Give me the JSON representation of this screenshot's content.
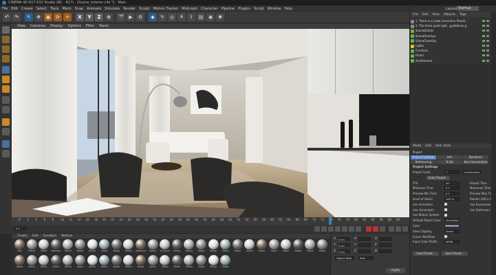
{
  "title": "CINEMA 4D R17.032 Studio (RC - R17) - [Scene_Interior.c4d *] - Main",
  "menubar": [
    "File",
    "Edit",
    "Create",
    "Select",
    "Tools",
    "Mesh",
    "Snap",
    "Animate",
    "Simulate",
    "Render",
    "Sculpt",
    "Motion Tracker",
    "MoGraph",
    "Character",
    "Pipeline",
    "Plugins",
    "Script",
    "Window",
    "Help"
  ],
  "axis_buttons": [
    "X",
    "Y",
    "Z"
  ],
  "viewport_menu": [
    "View",
    "Cameras",
    "Display",
    "Options",
    "Filter",
    "Panel"
  ],
  "timeline_ticks": [
    "0",
    "2",
    "4",
    "6",
    "8",
    "10",
    "12",
    "14",
    "16",
    "18",
    "20",
    "22",
    "24",
    "26",
    "28",
    "30",
    "32",
    "34",
    "36",
    "38",
    "40",
    "42",
    "44",
    "46",
    "48",
    "50",
    "52",
    "54",
    "56",
    "58",
    "60",
    "62",
    "64",
    "66",
    "68",
    "70",
    "72",
    "74",
    "76",
    "78",
    "80",
    "82",
    "84",
    "86",
    "88",
    "90"
  ],
  "timeline_end": "0 F",
  "material_menu": [
    "Create",
    "Edit",
    "Function",
    "Texture"
  ],
  "materials_row1": [
    "Mat",
    "Metal",
    "Metal",
    "Material",
    "Metal",
    "Metal",
    "Metal",
    "Glass",
    "Metal",
    "Metal",
    "Material",
    "Metal",
    "Chrome",
    "Metal",
    "Metal",
    "Metal",
    "Metal",
    "Metal",
    "Wood",
    "Metal",
    "Metal",
    "Glass",
    "Metal",
    "Metal",
    "Metal",
    "Metal"
  ],
  "materials_row2": [
    "Metal",
    "Metal",
    "Metal",
    "Metal",
    "Metal",
    "Metal",
    "Metal",
    "Metal",
    "Metal",
    "Metal",
    "Metal",
    "Metal",
    "Metal",
    "Metal",
    "Metal",
    "Metal",
    "Metal",
    "Metal"
  ],
  "coords": {
    "rows": [
      "X",
      "Y",
      "Z"
    ],
    "size_labels": [
      "X",
      "Y",
      "Z"
    ],
    "rot_labels": [
      "H",
      "P",
      "B"
    ],
    "values": [
      "0 cm",
      "0 cm",
      "0 cm"
    ],
    "mode": "Object (Rel)",
    "size_mode": "Size",
    "apply": "Apply"
  },
  "right_panel": {
    "layout_label": "Layout:",
    "layout_value": "Startup",
    "object_menu": [
      "File",
      "Edit",
      "View",
      "Objects",
      "Tags"
    ],
    "objects": [
      {
        "name": "1. There is a Cube Correction Preset...",
        "color": "#8a8a8a"
      },
      {
        "name": "2. The three point light...guidelines.g",
        "color": "#8a8a8a"
      },
      {
        "name": "SceneDetails",
        "color": "#6ab04c"
      },
      {
        "name": "SceneOverlays",
        "color": "#6ab04c"
      },
      {
        "name": "SceneCloseSky",
        "color": "#6ab04c"
      },
      {
        "name": "Lights",
        "color": "#e0c040"
      },
      {
        "name": "Furniture",
        "color": "#6ab04c"
      },
      {
        "name": "Floors",
        "color": "#6ab04c"
      },
      {
        "name": "Architecture",
        "color": "#6ab04c"
      }
    ],
    "attr_menu": [
      "Mode",
      "Edit",
      "User Data"
    ],
    "attr_title": "Project",
    "tabs": [
      "Project Settings",
      "Info",
      "Dynamics",
      "Referencing",
      "To Do",
      "Key Interpolation"
    ],
    "section": "Project Settings",
    "settings": [
      {
        "label": "Project Scale",
        "value": "1",
        "unit": "Centimeters"
      },
      {
        "label": "",
        "value": "Scale Project..."
      },
      {
        "label": "FPS",
        "value": "30",
        "right_label": "Project Time"
      },
      {
        "label": "Minimum Time",
        "value": "0 F",
        "right_label": "Maximum Time"
      },
      {
        "label": "Preview Min Time",
        "value": "0 F",
        "right_label": "Preview Max Time"
      },
      {
        "label": "Level of Detail",
        "value": "100 %",
        "right_label": "Render LOD in Editor"
      },
      {
        "label": "Use Animation",
        "value": "",
        "right_label": "Use Expression"
      },
      {
        "label": "Use Generators",
        "value": "",
        "right_label": "Use Deformers"
      },
      {
        "label": "Use Motion System",
        "value": "",
        "right_label": ""
      },
      {
        "label": "Default Object Color",
        "value": "Gray-Blue",
        "right_label": ""
      },
      {
        "label": "Color",
        "value": "",
        "right_label": ""
      },
      {
        "label": "View Clipping",
        "value": "Small",
        "right_label": ""
      },
      {
        "label": "Linear Workflow",
        "value": "",
        "right_label": ""
      },
      {
        "label": "Input Color Profile",
        "value": "sRGB",
        "right_label": ""
      }
    ],
    "buttons": [
      "Load Preset...",
      "Save Preset..."
    ]
  }
}
